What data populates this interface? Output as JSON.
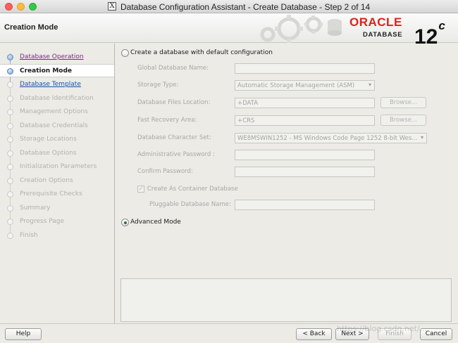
{
  "window": {
    "title": "Database Configuration Assistant - Create Database - Step 2 of 14",
    "x11_glyph": "X"
  },
  "header": {
    "step_heading": "Creation Mode",
    "brand_name": "ORACLE",
    "brand_product": "DATABASE",
    "version_number": "12",
    "version_suffix": "c"
  },
  "sidebar": {
    "steps": [
      {
        "label": "Database Operation",
        "state": "done"
      },
      {
        "label": "Creation Mode",
        "state": "current"
      },
      {
        "label": "Database Template",
        "state": "link"
      },
      {
        "label": "Database Identification",
        "state": "disabled"
      },
      {
        "label": "Management Options",
        "state": "disabled"
      },
      {
        "label": "Database Credentials",
        "state": "disabled"
      },
      {
        "label": "Storage Locations",
        "state": "disabled"
      },
      {
        "label": "Database Options",
        "state": "disabled"
      },
      {
        "label": "Initialization Parameters",
        "state": "disabled"
      },
      {
        "label": "Creation Options",
        "state": "disabled"
      },
      {
        "label": "Prerequisite Checks",
        "state": "disabled"
      },
      {
        "label": "Summary",
        "state": "disabled"
      },
      {
        "label": "Progress Page",
        "state": "disabled"
      },
      {
        "label": "Finish",
        "state": "disabled"
      }
    ]
  },
  "form": {
    "default_config_option": "Create a database with default configuration",
    "default_config_selected": false,
    "global_db_name": {
      "label": "Global Database Name:",
      "value": ""
    },
    "storage_type": {
      "label": "Storage Type:",
      "value": "Automatic Storage Management (ASM)"
    },
    "db_files_location": {
      "label": "Database Files Location:",
      "value": "+DATA",
      "browse": "Browse..."
    },
    "fast_recovery_area": {
      "label": "Fast Recovery Area:",
      "value": "+CRS",
      "browse": "Browse..."
    },
    "charset": {
      "label": "Database Character Set:",
      "value": "WE8MSWIN1252 - MS Windows Code Page 1252 8-bit Wes..."
    },
    "admin_password": {
      "label": "Administrative Password :",
      "value": ""
    },
    "confirm_password": {
      "label": "Confirm Password:",
      "value": ""
    },
    "container_db": {
      "label": "Create As Container Database",
      "checked": true
    },
    "pluggable_db_name": {
      "label": "Pluggable Database Name:",
      "value": ""
    },
    "advanced_mode_option": "Advanced Mode",
    "advanced_mode_selected": true
  },
  "buttons": {
    "help": "Help",
    "back": "< Back",
    "next": "Next >",
    "finish": "Finish",
    "cancel": "Cancel"
  },
  "watermark": "https://blog.csdn.net/..."
}
